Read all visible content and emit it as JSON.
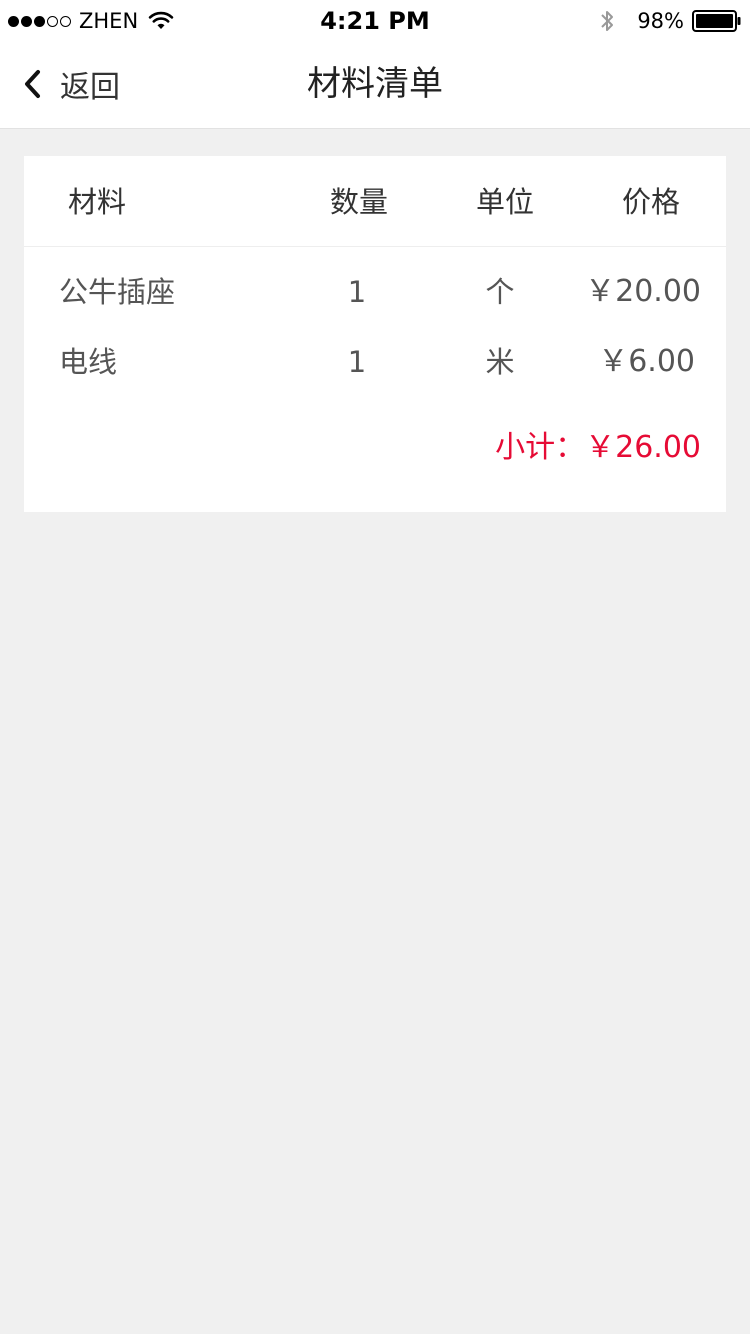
{
  "status_bar": {
    "carrier": "ZHEN",
    "time": "4:21 PM",
    "battery": "98%",
    "signal_bars_filled": 3,
    "signal_bars_total": 5
  },
  "nav": {
    "back_label": "返回",
    "title": "材料清单",
    "back_icon": "chevron-left-icon"
  },
  "table": {
    "headers": {
      "material": "材料",
      "quantity": "数量",
      "unit": "单位",
      "price": "价格"
    },
    "rows": [
      {
        "material": "公牛插座",
        "quantity": "1",
        "unit": "个",
        "price": "￥20.00"
      },
      {
        "material": "电线",
        "quantity": "1",
        "unit": "米",
        "price": "￥6.00"
      }
    ],
    "subtotal": "小计：￥26.00"
  },
  "colors": {
    "accent_red": "#e60b35",
    "background": "#f0f0f0",
    "card": "#ffffff"
  }
}
